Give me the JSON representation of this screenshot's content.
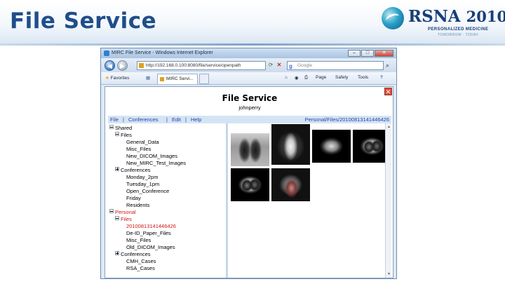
{
  "slide": {
    "title": "File Service"
  },
  "logo": {
    "text": "RSNA",
    "year": "2010",
    "tagline": "PERSONALIZED MEDICINE",
    "subtag": "TOMORROW · TODAY"
  },
  "browser": {
    "window_title": "MIRC File Service - Windows Internet Explorer",
    "url": "http://192.168.0.100:8080/file/service/openpath",
    "search_placeholder": "Google",
    "favorites_label": "Favorites",
    "tab_label": "MIRC Servi...",
    "toolbar": {
      "page": "Page",
      "safety": "Safety",
      "tools": "Tools",
      "help": "?"
    }
  },
  "page": {
    "title": "File Service",
    "user": "johnperry",
    "menu": [
      "File",
      "Conferences",
      "Edit",
      "Help"
    ],
    "menu_sep": "|",
    "current_path": "Personal/Files/20100813141446426"
  },
  "tree": [
    {
      "label": "Shared",
      "toggle": "minus"
    },
    {
      "label": "Files",
      "toggle": "minus"
    },
    {
      "label": "General_Data"
    },
    {
      "label": "Misc_Files"
    },
    {
      "label": "New_DICOM_Images"
    },
    {
      "label": "New_MIRC_Test_Images"
    },
    {
      "label": "Conferences",
      "toggle": "plus"
    },
    {
      "label": "Monday_2pm"
    },
    {
      "label": "Tuesday_1pm"
    },
    {
      "label": "Open_Conference"
    },
    {
      "label": "Friday"
    },
    {
      "label": "Residents"
    },
    {
      "label": "Personal",
      "toggle": "minus",
      "selected": true
    },
    {
      "label": "Files",
      "toggle": "minus",
      "selected": true
    },
    {
      "label": "20100813141446426",
      "selected": true
    },
    {
      "label": "De-ID_Paper_Files"
    },
    {
      "label": "Misc_Files"
    },
    {
      "label": "Old_DICOM_Images"
    },
    {
      "label": "Conferences",
      "toggle": "plus"
    },
    {
      "label": "CMH_Cases"
    },
    {
      "label": "RSA_Cases"
    }
  ],
  "thumbnails": [
    "chest-xray",
    "chest-xray-lateral",
    "ct-abdomen",
    "ct-chest",
    "ct-chest-2",
    "ct-chest-3"
  ]
}
